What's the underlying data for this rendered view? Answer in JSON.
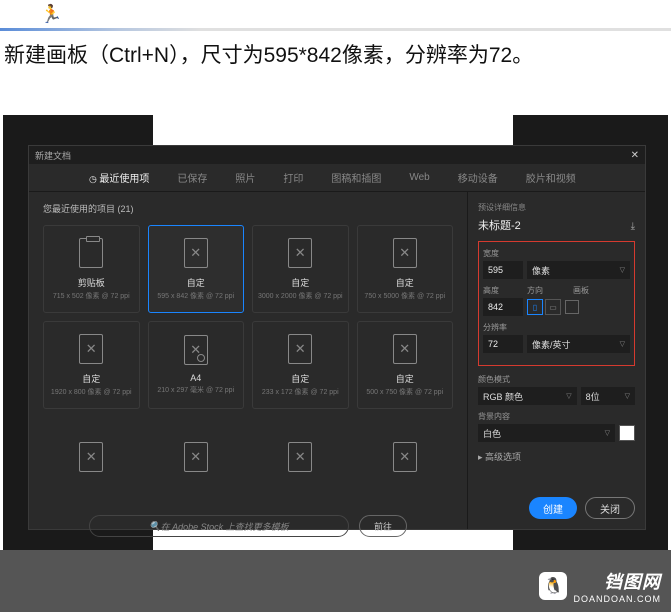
{
  "instruction": "新建画板（Ctrl+N），尺寸为595*842像素，分辨率为72。",
  "dialog": {
    "title": "新建文档",
    "tabs": [
      "最近使用项",
      "已保存",
      "照片",
      "打印",
      "图稿和插图",
      "Web",
      "移动设备",
      "胶片和视频"
    ],
    "recent_label": "您最近使用的项目 (21)",
    "presets": [
      {
        "name": "剪贴板",
        "dim": "715 x 502 像素 @ 72 ppi",
        "icon": "clip"
      },
      {
        "name": "自定",
        "dim": "595 x 842 像素 @ 72 ppi",
        "icon": "x",
        "selected": true
      },
      {
        "name": "自定",
        "dim": "3000 x 2000 像素 @ 72 ppi",
        "icon": "x"
      },
      {
        "name": "自定",
        "dim": "750 x 5000 像素 @ 72 ppi",
        "icon": "x"
      },
      {
        "name": "自定",
        "dim": "1920 x 800 像素 @ 72 ppi",
        "icon": "x"
      },
      {
        "name": "A4",
        "dim": "210 x 297 毫米 @ 72 ppi",
        "icon": "a4"
      },
      {
        "name": "自定",
        "dim": "233 x 172 像素 @ 72 ppi",
        "icon": "x"
      },
      {
        "name": "自定",
        "dim": "500 x 750 像素 @ 72 ppi",
        "icon": "x"
      },
      {
        "name": "",
        "dim": "",
        "icon": "x"
      },
      {
        "name": "",
        "dim": "",
        "icon": "x"
      },
      {
        "name": "",
        "dim": "",
        "icon": "x"
      },
      {
        "name": "",
        "dim": "",
        "icon": "x"
      }
    ],
    "search_placeholder": "在 Adobe Stock 上查找更多模板",
    "go": "前往"
  },
  "details": {
    "header": "预设详细信息",
    "doc_name": "未标题-2",
    "width_label": "宽度",
    "width": "595",
    "width_unit": "像素",
    "height_label": "高度",
    "orient_label": "方向",
    "artboard_label": "画板",
    "height": "842",
    "res_label": "分辨率",
    "res": "72",
    "res_unit": "像素/英寸",
    "color_mode_label": "颜色模式",
    "color_mode": "RGB 颜色",
    "bit_depth": "8位",
    "bg_label": "背景内容",
    "bg": "白色",
    "advanced": "▸ 高级选项",
    "create": "创建",
    "close": "关闭"
  },
  "watermark": {
    "cn": "铛图网",
    "en": "DOANDOAN.COM"
  }
}
